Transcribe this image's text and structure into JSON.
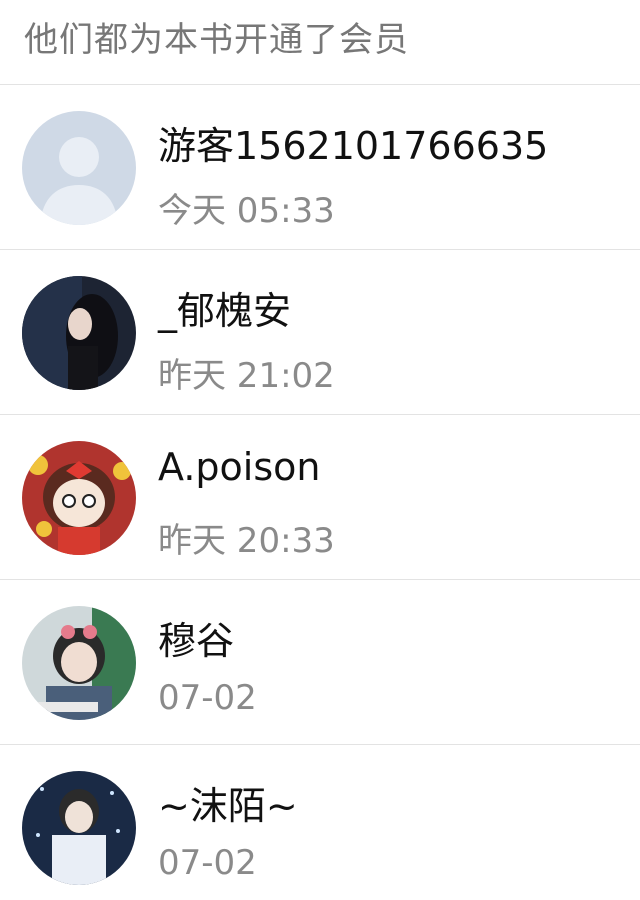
{
  "header": {
    "title": "他们都为本书开通了会员"
  },
  "members": [
    {
      "name": "游客1562101766635",
      "time": "今天 05:33",
      "avatar_icon": "default-avatar-icon",
      "avatar_bg": "#cfd9e6"
    },
    {
      "name": "_郁槐安",
      "time": "昨天 21:02",
      "avatar_icon": "profile-photo-icon",
      "avatar_bg": "#1d2433"
    },
    {
      "name": "A.poison",
      "time": "昨天 20:33",
      "avatar_icon": "cartoon-girl-icon",
      "avatar_bg": "#b0342e"
    },
    {
      "name": "穆谷",
      "time": "07-02",
      "avatar_icon": "profile-photo-icon",
      "avatar_bg": "#cfd8da"
    },
    {
      "name": "~沫陌~",
      "time": "07-02",
      "avatar_icon": "profile-photo-icon",
      "avatar_bg": "#1a2a45"
    }
  ]
}
